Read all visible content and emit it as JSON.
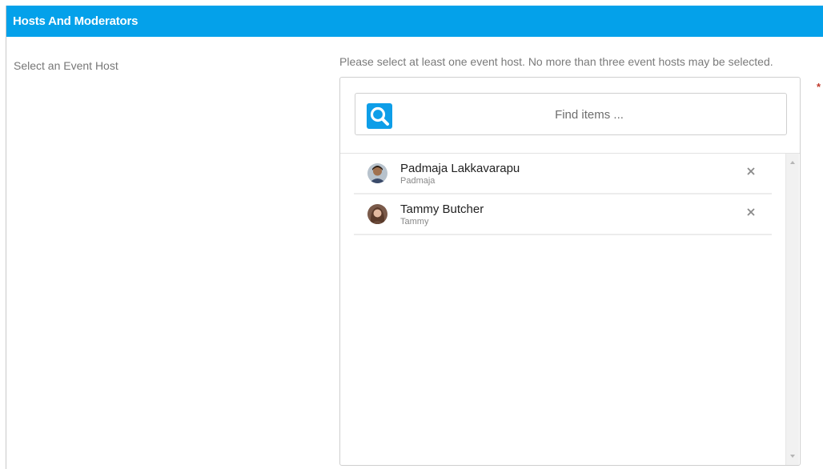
{
  "section": {
    "title": "Hosts And Moderators"
  },
  "field": {
    "label": "Select an Event Host",
    "help_text": "Please select at least one event host. No more than three event hosts may be selected.",
    "required_marker": "*"
  },
  "search": {
    "placeholder": "Find items ...",
    "value": "",
    "icon": "search-icon"
  },
  "selected_hosts": [
    {
      "name": "Padmaja Lakkavarapu",
      "username": "Padmaja",
      "remove_icon": "close-icon"
    },
    {
      "name": "Tammy Butcher",
      "username": "Tammy",
      "remove_icon": "close-icon"
    }
  ],
  "colors": {
    "header_bg": "#04a1ea",
    "search_icon_bg": "#0e9ee8",
    "required": "#c0392b"
  }
}
